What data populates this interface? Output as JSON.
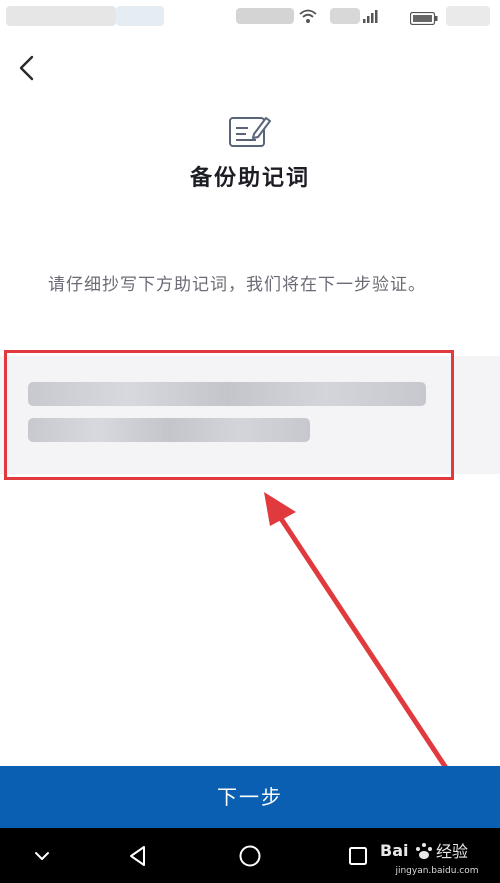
{
  "screen": {
    "title": "备份助记词",
    "instruction": "请仔细抄写下方助记词，我们将在下一步验证。"
  },
  "buttons": {
    "next": "下一步"
  },
  "watermark": {
    "logo_text": "Baidu经验",
    "url": "jingyan.baidu.com"
  },
  "icons": [
    "wifi-icon",
    "signal-icon",
    "battery-icon",
    "back-arrow-icon",
    "mnemonic-note-icon",
    "nav-down-icon",
    "nav-back-icon",
    "nav-home-icon",
    "nav-recent-icon"
  ],
  "colors": {
    "primary_button": "#0a5fb3",
    "title_text": "#1d1d26",
    "body_text": "#6b6b75",
    "annotation_red": "#e0393e",
    "mnemonic_panel": "#f4f4f6"
  }
}
